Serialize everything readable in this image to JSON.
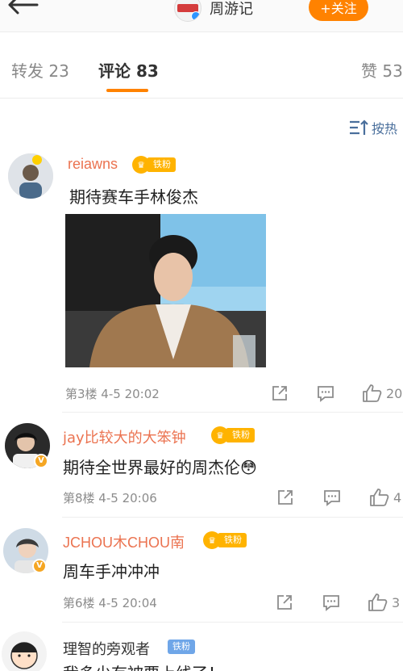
{
  "header": {
    "title": "周游记",
    "follow_label": "+关注"
  },
  "tabs": {
    "repost": "转发 23",
    "comment": "评论 83",
    "like": "赞 53"
  },
  "sort_label": "按热",
  "comments": [
    {
      "user": "reiawns",
      "badge": "铁粉",
      "text": "期待赛车手林俊杰",
      "meta": "第3楼  4-5 20:02",
      "likes": "20"
    },
    {
      "user": "jay比较大的大笨钟",
      "badge": "铁粉",
      "text": "期待全世界最好的周杰伦😳",
      "meta": "第8楼  4-5 20:06",
      "likes": "4"
    },
    {
      "user": "JCHOU木CHOU南",
      "badge": "铁粉",
      "text": "周车手冲冲冲",
      "meta": "第6楼  4-5 20:04",
      "likes": "3"
    },
    {
      "user": "理智的旁观者",
      "badge": "铁粉",
      "text": "我多少有被要上线了！"
    }
  ],
  "colors": {
    "accent": "#ff8200",
    "username": "#eb7350",
    "link": "#4a6f9c"
  }
}
